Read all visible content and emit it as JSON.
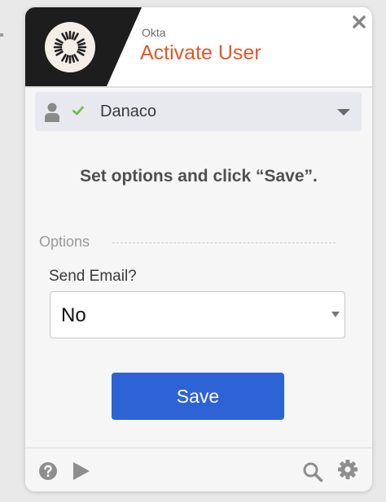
{
  "header": {
    "app_name": "Okta",
    "action_title": "Activate User"
  },
  "account": {
    "name": "Danaco",
    "status": "connected"
  },
  "instructions": "Set options and click “Save”.",
  "options_section": {
    "label": "Options",
    "send_email": {
      "label": "Send Email?",
      "value": "No"
    }
  },
  "save_label": "Save",
  "icons": {
    "close": "close-icon",
    "user": "user-icon",
    "check": "check-icon",
    "dropdown": "chevron-down-icon",
    "help": "help-icon",
    "play": "play-icon",
    "search": "search-icon",
    "settings": "gear-icon"
  },
  "colors": {
    "brand_dark": "#1d1d1d",
    "title": "#e2572b",
    "primary_button": "#2e63d6",
    "check": "#6cc04a"
  }
}
